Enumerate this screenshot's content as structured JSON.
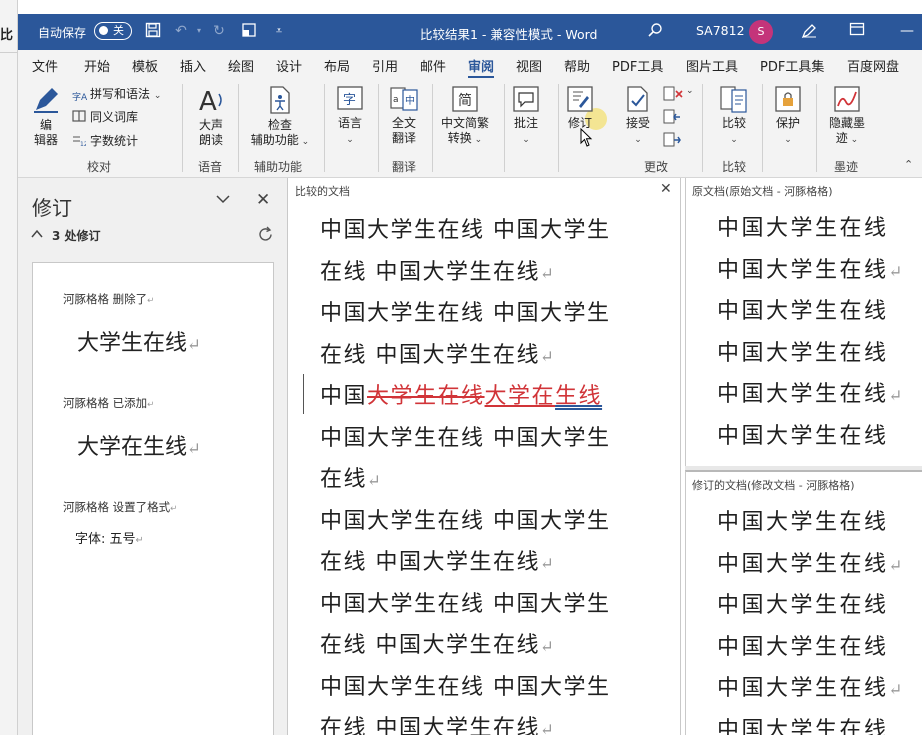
{
  "background_window": {
    "text": "比"
  },
  "titlebar": {
    "autosave_label": "自动保存",
    "autosave_state": "关",
    "doc_title": "比较结果1  -  兼容性模式  -  Word",
    "user_name": "SA7812",
    "avatar_initial": "S"
  },
  "menu": {
    "tabs": [
      "文件",
      "开始",
      "模板",
      "插入",
      "绘图",
      "设计",
      "布局",
      "引用",
      "邮件",
      "审阅",
      "视图",
      "帮助",
      "PDF工具",
      "图片工具",
      "PDF工具集",
      "百度网盘"
    ],
    "active": "审阅"
  },
  "ribbon": {
    "editor": "编\n辑器",
    "spelling": "拼写和语法",
    "thesaurus": "同义词库",
    "wordcount": "字数统计",
    "group_proofing": "校对",
    "read_aloud": "大声\n朗读",
    "group_speech": "语音",
    "accessibility": "检查\n辅助功能",
    "group_accessibility": "辅助功能",
    "language": "语言",
    "translate": "全文\n翻译",
    "group_translate": "翻译",
    "chinese_conversion": "中文简繁\n转换",
    "comments": "批注",
    "track_changes": "修订",
    "accept": "接受",
    "group_changes": "更改",
    "compare": "比较",
    "group_compare": "比较",
    "protect": "保护",
    "hide_ink": "隐藏墨\n迹",
    "group_ink": "墨迹"
  },
  "revision_pane": {
    "title": "修订",
    "count": "3 处修订",
    "items": [
      {
        "meta": "河豚格格  删除了",
        "text": "大学生在线"
      },
      {
        "meta": "河豚格格  已添加",
        "text": "大学在生线"
      },
      {
        "meta": "河豚格格  设置了格式",
        "detail": "字体: 五号"
      }
    ]
  },
  "compared_doc": {
    "header": "比较的文档",
    "lines_before": [
      "中国大学生在线  中国大学生",
      "在线  中国大学生在线",
      "中国大学生在线  中国大学生",
      "在线  中国大学生在线"
    ],
    "changed_line": {
      "prefix": "中国",
      "deleted": "大学生在线",
      "inserted_a": "大学在",
      "inserted_b": "生线"
    },
    "lines_after": [
      "中国大学生在线  中国大学生",
      "在线",
      "中国大学生在线  中国大学生",
      "在线  中国大学生在线",
      "中国大学生在线  中国大学生",
      "在线  中国大学生在线",
      "中国大学生在线  中国大学生",
      "在线  中国大学生在线"
    ]
  },
  "original_doc": {
    "header": "原文档(原始文档 - 河豚格格)",
    "lines": [
      "中国大学生在线",
      "中国大学生在线",
      "中国大学生在线",
      "中国大学生在线",
      "中国大学生在线",
      "中国大学生在线"
    ]
  },
  "revised_doc": {
    "header": "修订的文档(修改文档 - 河豚格格)",
    "lines": [
      "中国大学生在线",
      "中国大学生在线",
      "中国大学生在线",
      "中国大学生在线",
      "中国大学生在线",
      "中国大学生在线"
    ]
  }
}
